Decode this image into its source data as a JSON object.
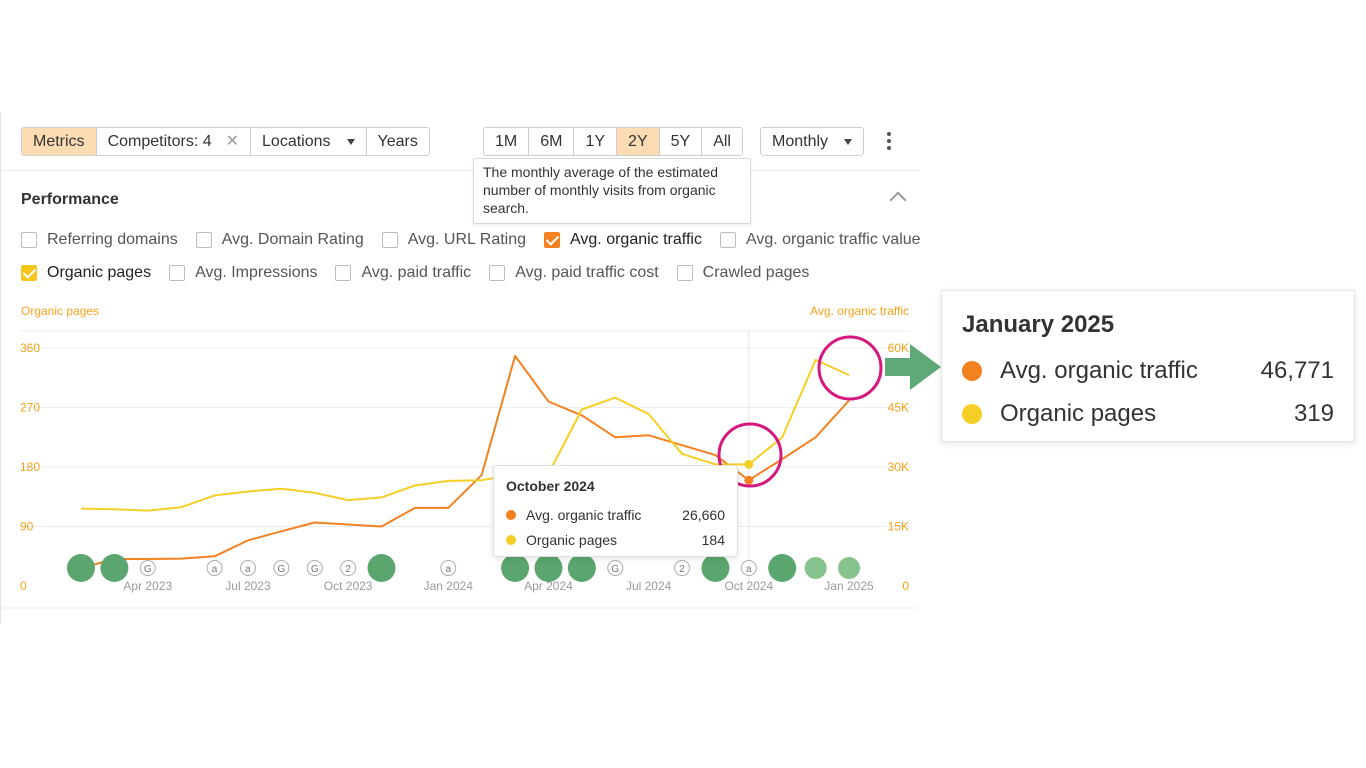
{
  "toolbar": {
    "metrics": "Metrics",
    "competitors": "Competitors: 4",
    "locations": "Locations",
    "years": "Years",
    "periods": [
      "1M",
      "6M",
      "1Y",
      "2Y",
      "5Y",
      "All"
    ],
    "active_period": "2Y",
    "monthly": "Monthly"
  },
  "info_tooltip": "The monthly average of the estimated number of monthly visits from organic search.",
  "performance": {
    "title": "Performance",
    "checkboxes_row1": [
      {
        "label": "Referring domains",
        "checked": false,
        "color": ""
      },
      {
        "label": "Avg. Domain Rating",
        "checked": false,
        "color": ""
      },
      {
        "label": "Avg. URL Rating",
        "checked": false,
        "color": ""
      },
      {
        "label": "Avg. organic traffic",
        "checked": true,
        "color": "#f48120"
      },
      {
        "label": "Avg. organic traffic value",
        "checked": false,
        "color": ""
      }
    ],
    "checkboxes_row2": [
      {
        "label": "Organic pages",
        "checked": true,
        "color": "#f6c71a"
      },
      {
        "label": "Avg. Impressions",
        "checked": false,
        "color": ""
      },
      {
        "label": "Avg. paid traffic",
        "checked": false,
        "color": ""
      },
      {
        "label": "Avg. paid traffic cost",
        "checked": false,
        "color": ""
      },
      {
        "label": "Crawled pages",
        "checked": false,
        "color": ""
      }
    ]
  },
  "colors": {
    "traffic": "#f48120",
    "pages": "#f6cf26",
    "accent_bg": "#fddcb4",
    "axis_text": "#f7a21b",
    "highlight_circle": "#d6177f",
    "arrow": "#5fa877",
    "event_dot": "#5aa66e",
    "event_dot_light": "#86c38e"
  },
  "chart_data": {
    "type": "line",
    "left_axis_title": "Organic pages",
    "right_axis_title": "Avg. organic traffic",
    "left_ticks": [
      "0",
      "90",
      "180",
      "270",
      "360"
    ],
    "right_ticks": [
      "0",
      "15K",
      "30K",
      "45K",
      "60K"
    ],
    "left_ylim": [
      0,
      360
    ],
    "right_ylim": [
      0,
      60000
    ],
    "x_ticks": [
      "Apr 2023",
      "Jul 2023",
      "Oct 2023",
      "Jan 2024",
      "Apr 2024",
      "Jul 2024",
      "Oct 2024",
      "Jan 2025"
    ],
    "x": [
      "Feb 2023",
      "Mar 2023",
      "Apr 2023",
      "May 2023",
      "Jun 2023",
      "Jul 2023",
      "Aug 2023",
      "Sep 2023",
      "Oct 2023",
      "Nov 2023",
      "Dec 2023",
      "Jan 2024",
      "Feb 2024",
      "Mar 2024",
      "Apr 2024",
      "May 2024",
      "Jun 2024",
      "Jul 2024",
      "Aug 2024",
      "Sep 2024",
      "Oct 2024",
      "Nov 2024",
      "Dec 2024",
      "Jan 2025"
    ],
    "series": [
      {
        "name": "Avg. organic traffic",
        "axis": "right",
        "color": "#f48120",
        "values": [
          4500,
          6800,
          6800,
          6900,
          7500,
          11500,
          13800,
          16000,
          15500,
          15000,
          19700,
          19700,
          28000,
          58000,
          46500,
          43000,
          37500,
          38000,
          35500,
          33000,
          26660,
          32000,
          37500,
          46771
        ]
      },
      {
        "name": "Organic pages",
        "axis": "left",
        "color": "#f6cf26",
        "values": [
          117,
          116,
          114,
          119,
          137,
          143,
          147,
          141,
          130,
          134,
          152,
          159,
          160,
          169,
          170,
          267,
          285,
          260,
          200,
          184,
          184,
          225,
          342,
          319
        ]
      }
    ],
    "event_markers": [
      {
        "month": "Feb 2023",
        "kind": "big",
        "label": ""
      },
      {
        "month": "Mar 2023",
        "kind": "big",
        "label": ""
      },
      {
        "month": "Apr 2023",
        "kind": "small",
        "label": "G"
      },
      {
        "month": "Jun 2023",
        "kind": "small",
        "label": "a"
      },
      {
        "month": "Jul 2023",
        "kind": "small",
        "label": "a"
      },
      {
        "month": "Aug 2023",
        "kind": "small",
        "label": "G"
      },
      {
        "month": "Sep 2023",
        "kind": "small",
        "label": "G"
      },
      {
        "month": "Oct 2023",
        "kind": "small",
        "label": "2"
      },
      {
        "month": "Nov 2023",
        "kind": "big",
        "label": ""
      },
      {
        "month": "Jan 2024",
        "kind": "small",
        "label": "a"
      },
      {
        "month": "Mar 2024",
        "kind": "big",
        "label": ""
      },
      {
        "month": "Apr 2024",
        "kind": "big",
        "label": ""
      },
      {
        "month": "May 2024",
        "kind": "big",
        "label": ""
      },
      {
        "month": "Jun 2024",
        "kind": "small",
        "label": "G"
      },
      {
        "month": "Aug 2024",
        "kind": "small",
        "label": "2"
      },
      {
        "month": "Sep 2024",
        "kind": "big",
        "label": ""
      },
      {
        "month": "Oct 2024",
        "kind": "small",
        "label": "a"
      },
      {
        "month": "Nov 2024",
        "kind": "big",
        "label": ""
      },
      {
        "month": "Dec 2024",
        "kind": "light",
        "label": ""
      },
      {
        "month": "Jan 2025",
        "kind": "light",
        "label": ""
      }
    ]
  },
  "hover_tooltip": {
    "title": "October 2024",
    "rows": [
      {
        "label": "Avg. organic traffic",
        "value": "26,660",
        "color": "#f48120"
      },
      {
        "label": "Organic pages",
        "value": "184",
        "color": "#f6cf26"
      }
    ]
  },
  "callout": {
    "title": "January 2025",
    "rows": [
      {
        "label": "Avg. organic traffic",
        "value": "46,771",
        "color": "#f48120"
      },
      {
        "label": "Organic pages",
        "value": "319",
        "color": "#f6cf26"
      }
    ]
  }
}
